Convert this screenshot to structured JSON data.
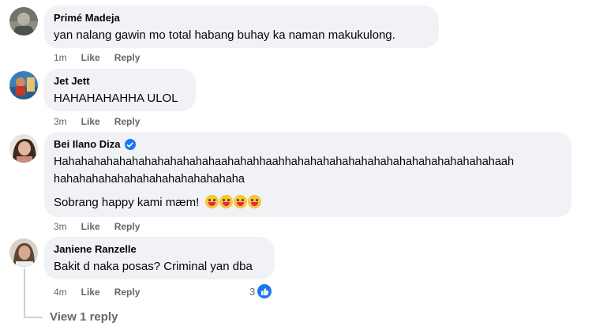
{
  "comments": [
    {
      "author": "Primé Madeja",
      "verified": false,
      "lines": [
        "yan nalang gawin mo total habang buhay ka naman makukulong."
      ],
      "time": "1m",
      "like": "Like",
      "reply": "Reply"
    },
    {
      "author": "Jet Jett",
      "verified": false,
      "lines": [
        "HAHAHAHAHHA ULOL"
      ],
      "time": "3m",
      "like": "Like",
      "reply": "Reply"
    },
    {
      "author": "Bei Ilano Diza",
      "verified": true,
      "lines": [
        "Hahahahahahahahahahahahahaahahahhaahhahahahahahahahahahahahahahahahahaah",
        "hahahahahahahahahahahahahahaha",
        "Sobrang happy kami mæm!"
      ],
      "emoji": [
        "grinning-tongue-emoji",
        "grinning-tongue-emoji",
        "grinning-tongue-emoji",
        "grinning-tongue-emoji"
      ],
      "time": "3m",
      "like": "Like",
      "reply": "Reply"
    },
    {
      "author": "Janiene Ranzelle",
      "verified": false,
      "lines": [
        "Bakit d naka posas? Criminal yan dba"
      ],
      "time": "4m",
      "like": "Like",
      "reply": "Reply",
      "reaction_count": "3"
    }
  ],
  "view_replies": "View 1 reply",
  "colors": {
    "bubble": "#f0f2f5",
    "meta": "#65676b",
    "accent": "#1877f2"
  }
}
